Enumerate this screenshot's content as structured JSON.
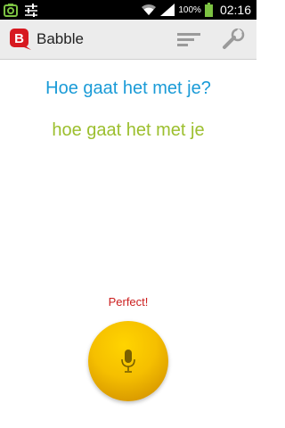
{
  "status_bar": {
    "battery_percent": "100%",
    "clock": "02:16",
    "icons": [
      "gallery-icon",
      "sliders-icon",
      "wifi-icon",
      "signal-icon",
      "battery-icon"
    ]
  },
  "action_bar": {
    "app_title": "Babble",
    "logo_letter": "B",
    "icons": [
      "filter-icon",
      "wrench-icon"
    ]
  },
  "content": {
    "question": "Hoe gaat het met je?",
    "answer": "hoe gaat het met je",
    "feedback": "Perfect!"
  },
  "colors": {
    "question": "#1a9bd7",
    "answer": "#9cbf2e",
    "feedback": "#cc1f1f",
    "mic_button": "#f5bf00",
    "logo": "#d71920"
  }
}
